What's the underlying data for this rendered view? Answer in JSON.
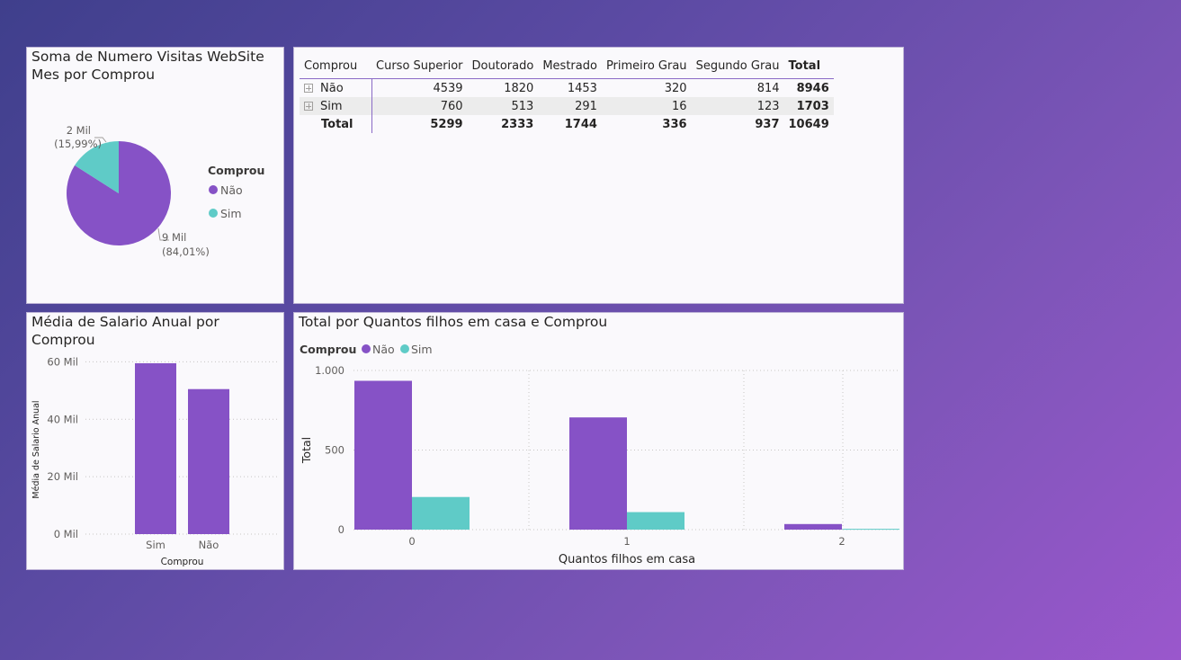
{
  "colors": {
    "nao": "#8652c6",
    "sim": "#5fcbc7",
    "grid": "#c8c6c4",
    "leader": "#a19f9d"
  },
  "pie_card": {
    "title": "Soma de Numero Visitas WebSite\nMes por Comprou",
    "legend_title": "Comprou",
    "slices": [
      {
        "name": "Não",
        "color": "#8652c6",
        "value_label": "9 Mil",
        "pct_label": "(84,01%)"
      },
      {
        "name": "Sim",
        "color": "#5fcbc7",
        "value_label": "2 Mil",
        "pct_label": "(15,99%)"
      }
    ]
  },
  "matrix": {
    "headers": [
      "Comprou",
      "Curso Superior",
      "Doutorado",
      "Mestrado",
      "Primeiro Grau",
      "Segundo Grau",
      "Total"
    ],
    "rows": [
      {
        "label": "Não",
        "values": [
          "4539",
          "1820",
          "1453",
          "320",
          "814"
        ],
        "total": "8946"
      },
      {
        "label": "Sim",
        "values": [
          "760",
          "513",
          "291",
          "16",
          "123"
        ],
        "total": "1703"
      },
      {
        "label": "Total",
        "values": [
          "5299",
          "2333",
          "1744",
          "336",
          "937"
        ],
        "total": "10649"
      }
    ]
  },
  "salary_card": {
    "title": "Média de Salario Anual por\nComprou"
  },
  "children_card": {
    "title": "Total por Quantos filhos em casa e Comprou"
  },
  "chart_data": [
    {
      "type": "pie",
      "title": "Soma de Numero Visitas WebSite Mes por Comprou",
      "legend_title": "Comprou",
      "legend_position": "right",
      "categories": [
        "Não",
        "Sim"
      ],
      "values": [
        8946,
        1703
      ],
      "labels": [
        "9 Mil (84,01%)",
        "2 Mil (15,99%)"
      ]
    },
    {
      "type": "bar",
      "title": "Média de Salario Anual por Comprou",
      "xlabel": "Comprou",
      "ylabel": "Média de Salario Anual",
      "categories": [
        "Sim",
        "Não"
      ],
      "values": [
        59500,
        50500
      ],
      "ylim": [
        0,
        62000
      ],
      "yticks": [
        0,
        20000,
        40000,
        60000
      ],
      "ytick_labels": [
        "0 Mil",
        "20 Mil",
        "40 Mil",
        "60 Mil"
      ],
      "grid": true,
      "color": "#8652c6"
    },
    {
      "type": "bar",
      "title": "Total por Quantos filhos em casa e Comprou",
      "xlabel": "Quantos filhos em casa",
      "ylabel": "Total",
      "legend_title": "Comprou",
      "legend_position": "top-left",
      "categories": [
        "0",
        "1",
        "2"
      ],
      "series": [
        {
          "name": "Não",
          "color": "#8652c6",
          "values": [
            935,
            705,
            35
          ]
        },
        {
          "name": "Sim",
          "color": "#5fcbc7",
          "values": [
            205,
            110,
            5
          ]
        }
      ],
      "ylim": [
        0,
        1000
      ],
      "yticks": [
        0,
        500,
        1000
      ],
      "ytick_labels": [
        "0",
        "500",
        "1.000"
      ],
      "grid": true
    }
  ]
}
